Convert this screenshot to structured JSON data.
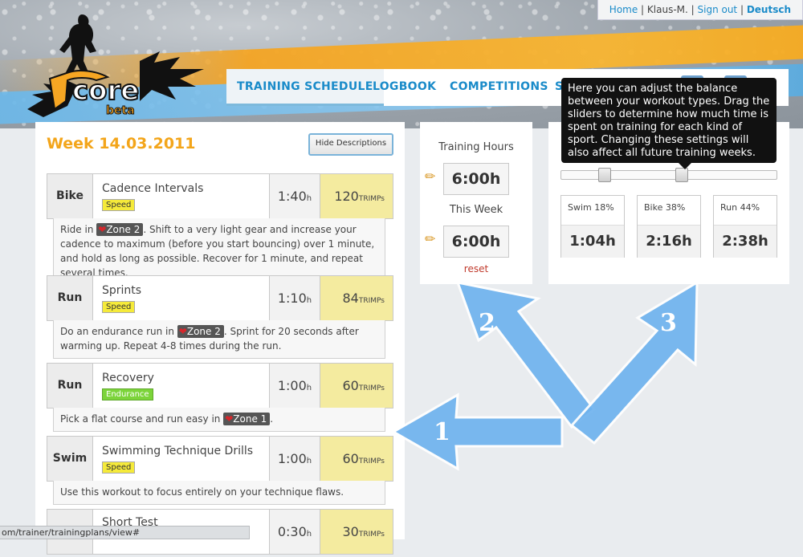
{
  "userbar": {
    "home": "Home",
    "user": "Klaus-M.",
    "signout": "Sign out",
    "language": "Deutsch"
  },
  "logo": {
    "text": "core",
    "badge": "beta"
  },
  "nav": {
    "items": [
      "TRAINING SCHEDULE",
      "LOGBOOK",
      "COMPETITIONS",
      "S"
    ]
  },
  "schedule": {
    "week_title": "Week 14.03.2011",
    "hide_descriptions": "Hide Descriptions",
    "workouts": [
      {
        "sport": "Bike",
        "name": "Cadence Intervals",
        "tag": "Speed",
        "duration": "1:40",
        "duration_unit": "h",
        "trimps": "120",
        "trimps_unit": "TRIMPs",
        "desc_before": "Ride in",
        "zone": "Zone 2",
        "desc_after": ". Shift to a very light gear and increase your cadence to maximum (before you start bouncing) over 1 minute, and hold as long as possible. Recover for 1 minute, and repeat several times."
      },
      {
        "sport": "Run",
        "name": "Sprints",
        "tag": "Speed",
        "duration": "1:10",
        "duration_unit": "h",
        "trimps": "84",
        "trimps_unit": "TRIMPs",
        "desc_before": "Do an endurance run in",
        "zone": "Zone 2",
        "desc_after": ". Sprint for 20 seconds after warming up. Repeat 4-8 times during the run."
      },
      {
        "sport": "Run",
        "name": "Recovery",
        "tag": "Endurance",
        "duration": "1:00",
        "duration_unit": "h",
        "trimps": "60",
        "trimps_unit": "TRIMPs",
        "desc_before": "Pick a flat course and run easy in",
        "zone": "Zone 1",
        "desc_after": "."
      },
      {
        "sport": "Swim",
        "name": "Swimming Technique Drills",
        "tag": "Speed",
        "duration": "1:00",
        "duration_unit": "h",
        "trimps": "60",
        "trimps_unit": "TRIMPs",
        "desc_before": "Use this workout to focus entirely on your technique flaws.",
        "zone": "",
        "desc_after": ""
      },
      {
        "sport": "",
        "name": "Short Test",
        "tag": "",
        "duration": "0:30",
        "duration_unit": "h",
        "trimps": "30",
        "trimps_unit": "TRIMPs"
      }
    ]
  },
  "hours": {
    "training_label": "Training Hours",
    "training_value": "6:00h",
    "week_label": "This Week",
    "week_value": "6:00h",
    "reset": "reset"
  },
  "balance": {
    "tooltip": "Here you can adjust the balance between your workout types. Drag the sliders to determine how much time is spent on training for each kind of sport. Changing these settings will also affect all future training weeks.",
    "slider_handles": [
      0.18,
      0.56
    ],
    "sports": [
      {
        "label": "Swim 18%",
        "value": "1:04h"
      },
      {
        "label": "Bike 38%",
        "value": "2:16h"
      },
      {
        "label": "Run 44%",
        "value": "2:38h"
      }
    ]
  },
  "callouts": [
    "1",
    "2",
    "3"
  ],
  "status_bar": "om/trainer/trainingplans/view#",
  "colors": {
    "accent_blue": "#1a8bc9",
    "week_orange": "#f3a51a",
    "trimp_bg": "#f4eb9f",
    "speed_tag": "#f5ea3a",
    "endurance_tag": "#7cd43a",
    "arrow_blue": "#6fb3ee"
  }
}
